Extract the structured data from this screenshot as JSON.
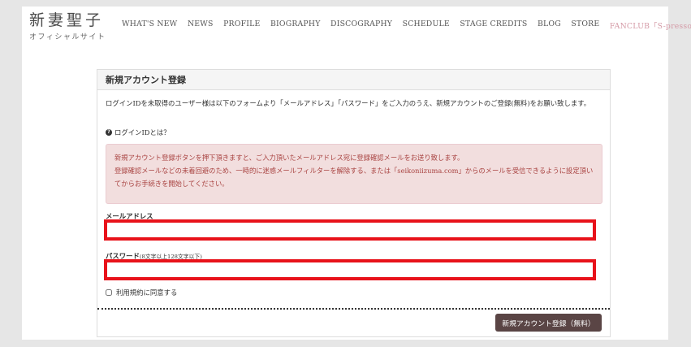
{
  "site": {
    "logo_main": "新妻聖子",
    "logo_sub": "オフィシャルサイト"
  },
  "nav": {
    "items": [
      "WHAT'S NEW",
      "NEWS",
      "PROFILE",
      "BIOGRAPHY",
      "DISCOGRAPHY",
      "SCHEDULE",
      "STAGE CREDITS",
      "BLOG",
      "STORE"
    ],
    "fanclub": "FANCLUB「S-presso!」",
    "fanclub_color": "#d49aa6"
  },
  "form": {
    "title": "新規アカウント登録",
    "intro": "ログインIDを未取得のユーザー様は以下のフォームより「メールアドレス」「パスワード」をご入力のうえ、新規アカウントのご登録(無料)をお願い致します。",
    "help_link": "ログインIDとは？",
    "help_icon": "question-circle-icon",
    "alert_line1": "新規アカウント登録ボタンを押下頂きますと、ご入力頂いたメールアドレス宛に登録確認メールをお送り致します。",
    "alert_line2": "登録確認メールなどの未着回避のため、一時的に迷惑メールフィルターを解除する、または「seikoniizuma.com」からのメールを受信できるように設定頂いてからお手続きを開始してください。",
    "email_label": "メールアドレス",
    "email_value": "",
    "password_label": "パスワード",
    "password_note": "(8文字以上128文字以下)",
    "password_value": "",
    "agree_label": "利用規約に同意する",
    "agree_checked": false,
    "submit_label": "新規アカウント登録（無料）",
    "highlight_color": "#e8121a",
    "alert_bg": "#f2dede",
    "alert_text_color": "#a94442",
    "button_color": "#5a4545"
  }
}
